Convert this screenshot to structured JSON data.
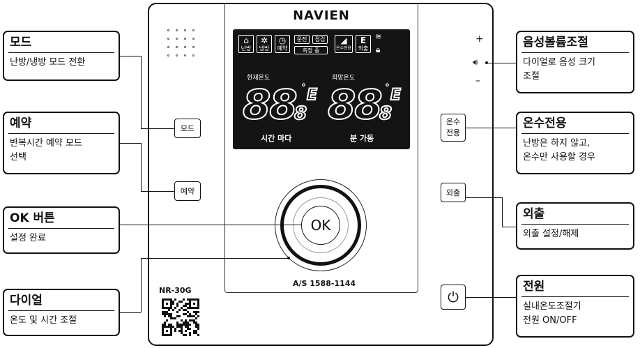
{
  "device": {
    "brand": "NAVIEN",
    "model": "NR-30G",
    "service": "A/S 1588-1144",
    "lcd": {
      "icons": [
        {
          "label": "난방",
          "icon": "house-heating-icon"
        },
        {
          "label": "냉방",
          "icon": "snowflake-icon"
        },
        {
          "label": "예약",
          "icon": "clock-icon"
        },
        {
          "label": "온수전용",
          "icon": "faucet-icon"
        },
        {
          "label": "외출",
          "icon": "outing-e-icon"
        }
      ],
      "tag_run": "운전",
      "tag_check": "점검",
      "tag_measure": "측정 중",
      "current_temp_label": "현재온도",
      "target_temp_label": "희망온도",
      "current_temp_value": "88",
      "current_temp_decimal": "8",
      "target_temp_value": "88",
      "target_temp_decimal": "8",
      "unit_current": "°",
      "unit_current_letter": "E",
      "unit_target": "°",
      "unit_target_letter": "E",
      "time_interval_label": "시간 마다",
      "minute_run_label": "분 가동"
    },
    "buttons": {
      "mode": "모드",
      "reserve": "예약",
      "hot_water_line1": "온수",
      "hot_water_line2": "전용",
      "outing": "외출",
      "ok": "OK",
      "vol_plus": "+",
      "vol_minus": "–"
    }
  },
  "callouts": {
    "mode": {
      "title": "모드",
      "desc": "난방/냉방 모드 전환"
    },
    "reserve": {
      "title": "예약",
      "desc_line1": "반복시간 예약 모드",
      "desc_line2": "선택"
    },
    "ok": {
      "title": "OK 버튼",
      "desc": "설정 완료"
    },
    "dial": {
      "title": "다이얼",
      "desc": "온도 및 시간 조절"
    },
    "volume": {
      "title": "음성볼륨조절",
      "desc_line1": "다이얼로 음성 크기",
      "desc_line2": "조절"
    },
    "hot_water": {
      "title": "온수전용",
      "desc_line1": "난방은 하지 않고,",
      "desc_line2": "온수만 사용할 경우"
    },
    "outing": {
      "title": "외출",
      "desc": "외출 설정/해제"
    },
    "power": {
      "title": "전원",
      "desc_line1": "실내온도조절기",
      "desc_line2": "전원 ON/OFF"
    }
  }
}
